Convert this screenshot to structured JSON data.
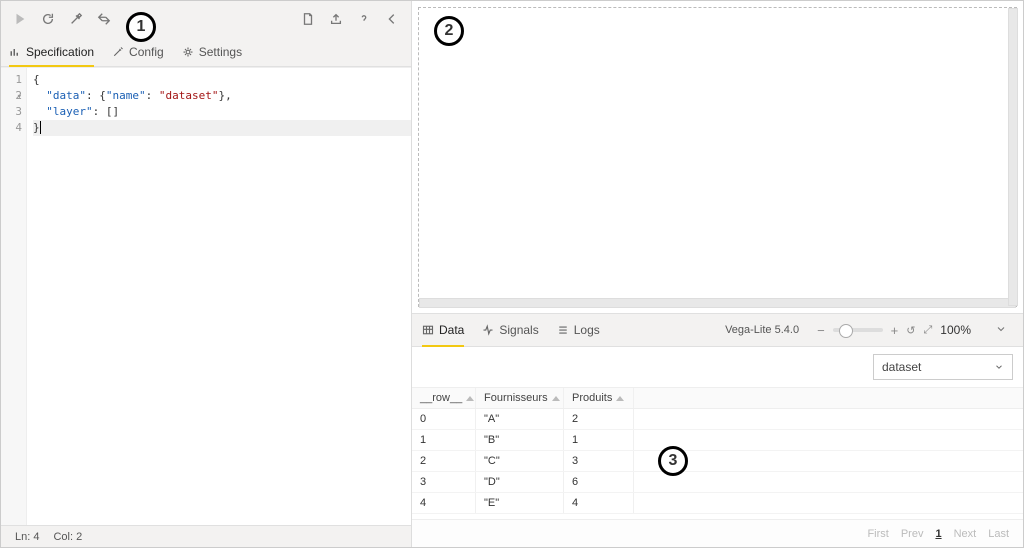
{
  "annotations": {
    "a1": "1",
    "a2": "2",
    "a3": "3"
  },
  "left": {
    "tabs": {
      "spec": "Specification",
      "config": "Config",
      "settings": "Settings"
    },
    "code": {
      "l1": "{",
      "l2_key_data": "\"data\"",
      "l2_mid": ": {",
      "l2_key_name": "\"name\"",
      "l2_mid2": ": ",
      "l2_val": "\"dataset\"",
      "l2_end": "},",
      "l3_key": "\"layer\"",
      "l3_rest": ": []",
      "l4": "}"
    },
    "gutter": {
      "g1": "1",
      "g2": "2",
      "g3": "3",
      "g4": "4"
    },
    "status": {
      "ln_label": "Ln:",
      "ln_val": "4",
      "col_label": "Col:",
      "col_val": "2"
    }
  },
  "right": {
    "tabs": {
      "data": "Data",
      "signals": "Signals",
      "logs": "Logs"
    },
    "vega": "Vega-Lite 5.4.0",
    "zoom": "100%",
    "dataset_select": "dataset",
    "table": {
      "col_row": "__row__",
      "col_f": "Fournisseurs",
      "col_p": "Produits",
      "rows": [
        {
          "r": "0",
          "f": "\"A\"",
          "p": "2"
        },
        {
          "r": "1",
          "f": "\"B\"",
          "p": "1"
        },
        {
          "r": "2",
          "f": "\"C\"",
          "p": "3"
        },
        {
          "r": "3",
          "f": "\"D\"",
          "p": "6"
        },
        {
          "r": "4",
          "f": "\"E\"",
          "p": "4"
        }
      ]
    },
    "pager": {
      "first": "First",
      "prev": "Prev",
      "page": "1",
      "next": "Next",
      "last": "Last"
    }
  },
  "chart_data": {
    "type": "table",
    "columns": [
      "__row__",
      "Fournisseurs",
      "Produits"
    ],
    "rows": [
      [
        0,
        "A",
        2
      ],
      [
        1,
        "B",
        1
      ],
      [
        2,
        "C",
        3
      ],
      [
        3,
        "D",
        6
      ],
      [
        4,
        "E",
        4
      ]
    ]
  }
}
